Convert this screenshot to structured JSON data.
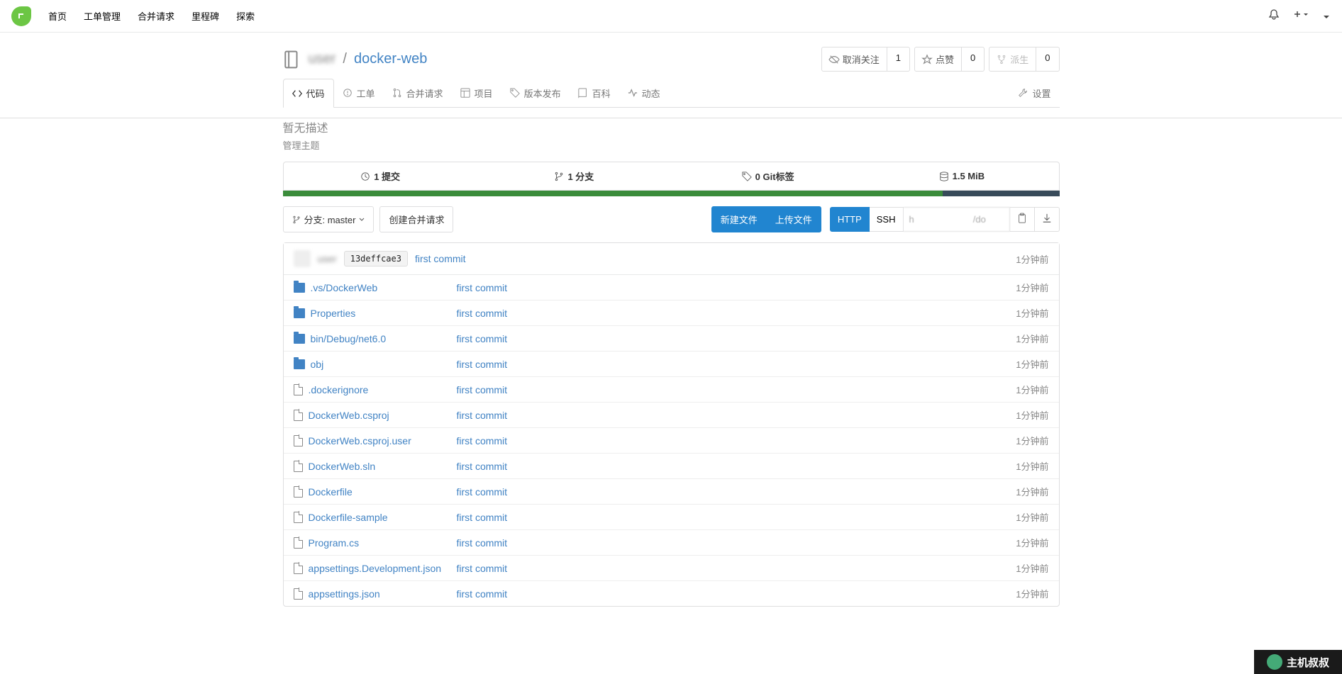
{
  "nav": {
    "home": "首页",
    "issues": "工单管理",
    "pulls": "合并请求",
    "milestones": "里程碑",
    "explore": "探索"
  },
  "repo": {
    "owner": "user",
    "sep": "/",
    "name": "docker-web",
    "watch": {
      "label": "取消关注",
      "count": "1"
    },
    "star": {
      "label": "点赞",
      "count": "0"
    },
    "fork": {
      "label": "派生",
      "count": "0"
    }
  },
  "tabs": {
    "code": "代码",
    "issues": "工单",
    "pulls": "合并请求",
    "projects": "项目",
    "releases": "版本发布",
    "wiki": "百科",
    "activity": "动态",
    "settings": "设置"
  },
  "desc": "暂无描述",
  "topics": "管理主题",
  "stats": {
    "commits": "1 提交",
    "branches": "1 分支",
    "tags": "0 Git标签",
    "size": "1.5 MiB"
  },
  "toolbar": {
    "branch": "分支: master",
    "newpr": "创建合并请求",
    "newfile": "新建文件",
    "upload": "上传文件",
    "http": "HTTP",
    "ssh": "SSH",
    "url": "h                       /do"
  },
  "latest": {
    "author": "user",
    "sha": "13deffcae3",
    "msg": "first commit",
    "time": "1分钟前"
  },
  "files": [
    {
      "type": "dir",
      "name": ".vs/DockerWeb",
      "msg": "first commit",
      "time": "1分钟前"
    },
    {
      "type": "dir",
      "name": "Properties",
      "msg": "first commit",
      "time": "1分钟前"
    },
    {
      "type": "dir",
      "name": "bin/Debug/net6.0",
      "msg": "first commit",
      "time": "1分钟前"
    },
    {
      "type": "dir",
      "name": "obj",
      "msg": "first commit",
      "time": "1分钟前"
    },
    {
      "type": "file",
      "name": ".dockerignore",
      "msg": "first commit",
      "time": "1分钟前"
    },
    {
      "type": "file",
      "name": "DockerWeb.csproj",
      "msg": "first commit",
      "time": "1分钟前"
    },
    {
      "type": "file",
      "name": "DockerWeb.csproj.user",
      "msg": "first commit",
      "time": "1分钟前"
    },
    {
      "type": "file",
      "name": "DockerWeb.sln",
      "msg": "first commit",
      "time": "1分钟前"
    },
    {
      "type": "file",
      "name": "Dockerfile",
      "msg": "first commit",
      "time": "1分钟前"
    },
    {
      "type": "file",
      "name": "Dockerfile-sample",
      "msg": "first commit",
      "time": "1分钟前"
    },
    {
      "type": "file",
      "name": "Program.cs",
      "msg": "first commit",
      "time": "1分钟前"
    },
    {
      "type": "file",
      "name": "appsettings.Development.json",
      "msg": "first commit",
      "time": "1分钟前"
    },
    {
      "type": "file",
      "name": "appsettings.json",
      "msg": "first commit",
      "time": "1分钟前"
    }
  ],
  "watermark": "主机叔叔"
}
